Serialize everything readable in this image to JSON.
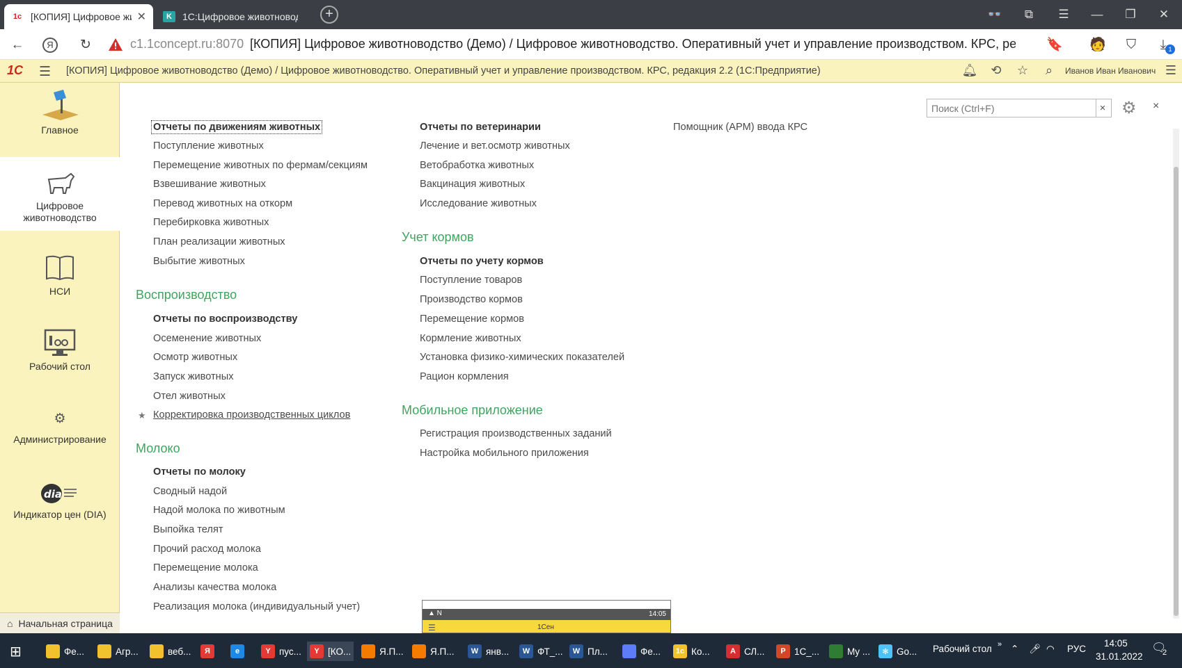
{
  "browser": {
    "tabs": [
      {
        "title": "[КОПИЯ] Цифровое жи",
        "favicon": "1c-logo-icon"
      },
      {
        "title": "1С:Цифровое животновод",
        "favicon": "k-logo-icon"
      }
    ],
    "new_tab_symbol": "+",
    "address": {
      "host": "c1.1concept.ru:8070",
      "page_title": "[КОПИЯ] Цифровое животноводство (Демо) / Цифровое животноводство. Оперативный учет и управление производством. КРС, ре..."
    },
    "download_badge": "1"
  },
  "header": {
    "logo": "1С",
    "title": "[КОПИЯ] Цифровое животноводство (Демо) / Цифровое животноводство. Оперативный учет и управление производством. КРС, редакция 2.2  (1С:Предприятие)",
    "user": "Иванов Иван Иванович"
  },
  "sidebar": {
    "items": [
      {
        "label": "Главное",
        "icon": "desk-lamp-icon"
      },
      {
        "label": "Цифровое животноводство",
        "icon": "cow-icon",
        "active": true
      },
      {
        "label": "НСИ",
        "icon": "book-icon"
      },
      {
        "label": "Рабочий стол",
        "icon": "monitor-icon"
      },
      {
        "label": "Администрирование",
        "icon": "gear-icon"
      },
      {
        "label": "Индикатор цен (DIA)",
        "icon": "dia-logo-icon"
      }
    ],
    "home": "Начальная страница"
  },
  "search": {
    "placeholder": "Поиск (Ctrl+F)",
    "clear": "×"
  },
  "close_symbol": "×",
  "menu": {
    "col1": {
      "links": [
        "Отчеты по движениям животных",
        "Поступление животных",
        "Перемещение животных по фермам/секциям",
        "Взвешивание животных",
        "Перевод животных на откорм",
        "Перебирковка животных",
        "План реализации животных",
        "Выбытие животных"
      ],
      "repro_title": "Воспроизводство",
      "repro": [
        "Отчеты по воспроизводству",
        "Осеменение животных",
        "Осмотр животных",
        "Запуск животных",
        "Отел животных",
        "Корректировка производственных циклов"
      ],
      "milk_title": "Молоко",
      "milk": [
        "Отчеты по молоку",
        "Сводный надой",
        "Надой молока по животным",
        "Выпойка телят",
        "Прочий расход молока",
        "Перемещение молока",
        "Анализы качества молока",
        "Реализация молока (индивидуальный учет)"
      ]
    },
    "col2": {
      "vet": [
        "Отчеты по ветеринарии",
        "Лечение и вет.осмотр животных",
        "Ветобработка животных",
        "Вакцинация животных",
        "Исследование животных"
      ],
      "feed_title": "Учет кормов",
      "feed": [
        "Отчеты по учету кормов",
        "Поступление товаров",
        "Производство кормов",
        "Перемещение кормов",
        "Кормление животных",
        "Установка физико-химических показателей",
        "Рацион кормления"
      ],
      "mobile_title": "Мобильное приложение",
      "mobile": [
        "Регистрация производственных заданий",
        "Настройка мобильного приложения"
      ]
    },
    "col3": {
      "links": [
        "Помощник (АРМ) ввода КРС"
      ]
    }
  },
  "phone_preview": {
    "time": "14:05",
    "app": "1Сен"
  },
  "taskbar": {
    "items": [
      {
        "label": "Фе...",
        "color": "#f2c12e"
      },
      {
        "label": "Агр...",
        "color": "#f2c12e"
      },
      {
        "label": "веб...",
        "color": "#f2c12e"
      },
      {
        "label": "",
        "color": "#e53935",
        "glyph": "Я"
      },
      {
        "label": "",
        "color": "#1e88e5",
        "glyph": "e"
      },
      {
        "label": "пус...",
        "color": "#e53935",
        "glyph": "Y"
      },
      {
        "label": "[КО...",
        "color": "#e53935",
        "glyph": "Y",
        "selected": true
      },
      {
        "label": "Я.П...",
        "color": "#f57c00"
      },
      {
        "label": "Я.П...",
        "color": "#f57c00"
      },
      {
        "label": "янв...",
        "color": "#2b5797",
        "glyph": "W"
      },
      {
        "label": "ФТ_...",
        "color": "#2b5797",
        "glyph": "W"
      },
      {
        "label": "Пл...",
        "color": "#2b5797",
        "glyph": "W"
      },
      {
        "label": "Фе...",
        "color": "#5c7cfa"
      },
      {
        "label": "Ко...",
        "color": "#f2c12e",
        "glyph": "1c"
      },
      {
        "label": "СЛ...",
        "color": "#d32f2f",
        "glyph": "A"
      },
      {
        "label": "1С_...",
        "color": "#d24726",
        "glyph": "P"
      },
      {
        "label": "My ...",
        "color": "#2e7d32"
      },
      {
        "label": "Go...",
        "color": "#4fc3f7",
        "glyph": "✻"
      }
    ],
    "desktop": "Рабочий стол",
    "lang": "РУС",
    "time": "14:05",
    "date": "31.01.2022",
    "notif": "2"
  }
}
